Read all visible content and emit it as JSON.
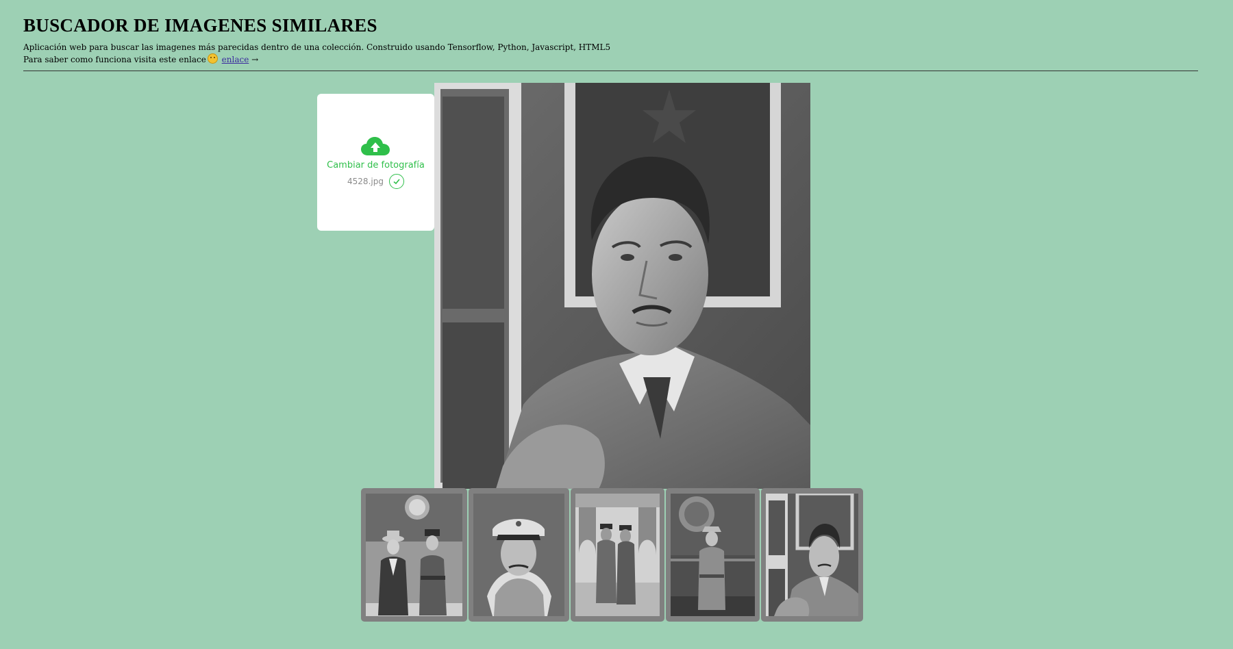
{
  "header": {
    "title": "BUSCADOR DE IMAGENES SIMILARES",
    "description": "Aplicación web para buscar las imagenes más parecidas dentro de una colección. Construido usando Tensorflow, Python, Javascript, HTML5",
    "how_text": "Para saber como funciona visita este enlace",
    "link_text": "enlace",
    "arrow": "→",
    "emoji_icon": "smiling-face-icon"
  },
  "upload": {
    "label": "Cambiar de fotografía",
    "filename": "4528.jpg",
    "icon": "cloud-upload-icon",
    "status_icon": "check-circle-icon",
    "accent_color": "#2fbf4a"
  },
  "main_image": {
    "alt": "Fotografía en blanco y negro de un militar con uniforme"
  },
  "results": [
    {
      "alt": "Dos hombres de pie, uno con sombrero y traje y otro con uniforme militar"
    },
    {
      "alt": "Retrato de un soldado con gorra de plato"
    },
    {
      "alt": "Dos militares de pie en un pasillo con arcos"
    },
    {
      "alt": "Militar posando frente a un vehículo con escudo"
    },
    {
      "alt": "Militar con uniforme sosteniendo una gorra"
    }
  ],
  "colors": {
    "background": "#9dd0b4",
    "thumb_frame": "#808080"
  }
}
